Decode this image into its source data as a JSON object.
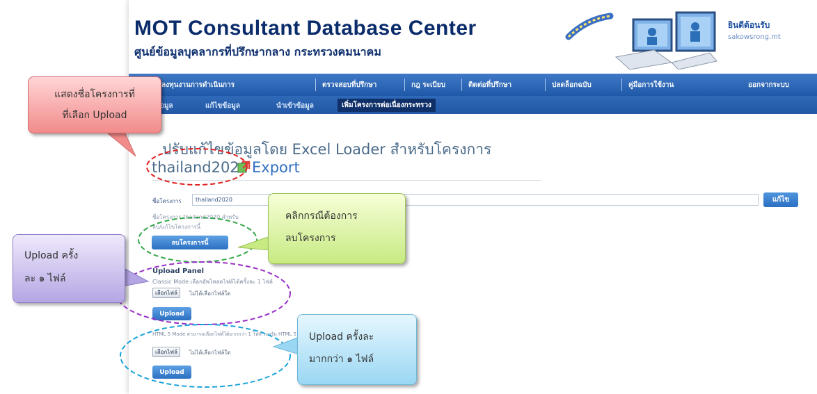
{
  "header": {
    "title": "MOT Consultant Database Center",
    "subtitle": "ศูนย์ข้อมูลบุคลากรที่ปรึกษากลาง กระทรวงคมนาคม",
    "welcome": "ยินดีต้อนรับ",
    "user": "sakowsrong.mt"
  },
  "nav": {
    "top_items": [
      "การลงทุนงานการดำเนินการ",
      "ตรวจสอบที่ปรึกษา",
      "กฎ ระเบียบ",
      "ติดต่อที่ปรึกษา",
      "ปลดล็อกฉบับ",
      "คู่มือการใช้งาน",
      "ออกจากระบบ"
    ],
    "sub_items": [
      "ข้อมูล",
      "แก้ไขข้อมูล",
      "นำเข้าข้อมูล",
      "เพิ่มโครงการต่อเนื่องกระทรวง"
    ]
  },
  "content": {
    "heading": "ปรับแก้ไขข้อมูลโดย Excel Loader สำหรับโครงการ",
    "project_name": "thailand2020",
    "export_label": "Export",
    "field_label": "ชื่อโครงการ",
    "project_value": "thailand2020",
    "edit_label": "แก้ไข",
    "hint_line1": "ชื่อโครงการ thailand2020 สำหรับ",
    "hint_line2": "ลบ/แก้ไขโครงการนี้",
    "delete_label": "ลบโครงการนี้",
    "panel_title": "Upload Panel",
    "classic_desc": "Classic Mode เลือกอัพโหลดไฟล์ได้ครั้งละ 1 ไฟล์",
    "choose_file": "เลือกไฟล์",
    "no_file": "ไม่ได้เลือกไฟล์ใด",
    "upload_label": "Upload",
    "html5_desc": "HTML 5 Mode สามารถเลือกไฟล์ได้มากกว่า 1 ไฟล์ รองรับ HTML 5"
  },
  "callouts": {
    "red": [
      "แสดงชื่อโครงการที่",
      "ที่เลือก Upload"
    ],
    "green": [
      "คลิกกรณีต้องการ",
      "ลบโครงการ"
    ],
    "purple": [
      "Upload ครั้ง",
      "ละ ๑ ไฟล์"
    ],
    "blue": [
      "Upload ครั้งละ",
      "มากกว่า ๑ ไฟล์"
    ]
  },
  "colors": {
    "brand": "#0b2c6b",
    "nav": "#2a63b2",
    "button": "#2b6fc2",
    "red_circle": "#e02020",
    "green_circle": "#35a84a",
    "purple_circle": "#9a30c8",
    "blue_circle": "#1aa3d9"
  }
}
